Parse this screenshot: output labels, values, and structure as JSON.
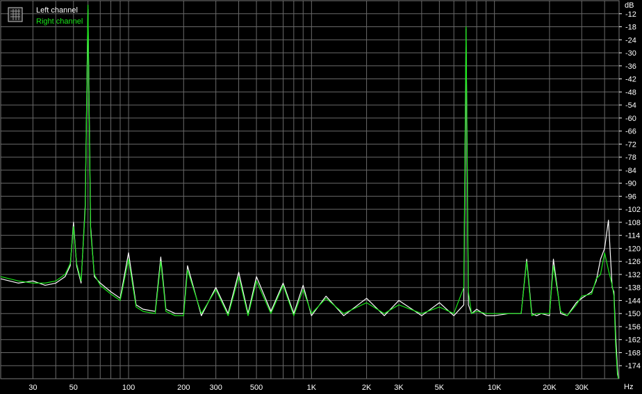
{
  "chart_data": {
    "type": "line",
    "title": "",
    "xlabel": "Hz",
    "ylabel": "dB",
    "x_scale": "log",
    "xlim": [
      20,
      48000
    ],
    "ylim": [
      -180,
      -6
    ],
    "grid": true,
    "legend_position": "top-left",
    "colors": {
      "background": "#000000",
      "grid": "#6a6a6a",
      "left": "#ffffff",
      "right": "#19e619",
      "text": "#ffffff"
    },
    "x_ticks": [
      {
        "v": 30,
        "label": "30"
      },
      {
        "v": 50,
        "label": "50"
      },
      {
        "v": 100,
        "label": "100"
      },
      {
        "v": 200,
        "label": "200"
      },
      {
        "v": 300,
        "label": "300"
      },
      {
        "v": 500,
        "label": "500"
      },
      {
        "v": 1000,
        "label": "1K"
      },
      {
        "v": 2000,
        "label": "2K"
      },
      {
        "v": 3000,
        "label": "3K"
      },
      {
        "v": 5000,
        "label": "5K"
      },
      {
        "v": 10000,
        "label": "10K"
      },
      {
        "v": 20000,
        "label": "20K"
      },
      {
        "v": 30000,
        "label": "30K"
      }
    ],
    "y_ticks": [
      -12,
      -18,
      -24,
      -30,
      -36,
      -42,
      -48,
      -54,
      -60,
      -66,
      -72,
      -78,
      -84,
      -90,
      -96,
      -102,
      -108,
      -114,
      -120,
      -126,
      -132,
      -138,
      -144,
      -150,
      -156,
      -162,
      -168,
      -174
    ],
    "series": [
      {
        "name": "Left channel",
        "x": [
          20,
          25,
          30,
          35,
          40,
          45,
          48,
          50,
          52,
          55,
          58,
          60,
          62,
          65,
          70,
          80,
          90,
          100,
          110,
          120,
          140,
          150,
          160,
          180,
          200,
          210,
          250,
          300,
          350,
          400,
          450,
          500,
          600,
          700,
          800,
          900,
          1000,
          1200,
          1500,
          2000,
          2500,
          3000,
          4000,
          5000,
          6000,
          6800,
          7000,
          7200,
          7500,
          8000,
          9000,
          10000,
          12000,
          14000,
          15000,
          16000,
          17000,
          18000,
          20000,
          21000,
          23000,
          25000,
          28000,
          30000,
          34000,
          36000,
          38000,
          40000,
          42000,
          44000,
          45000,
          46000,
          47000,
          48000
        ],
        "y": [
          -134,
          -136,
          -135,
          -137,
          -136,
          -133,
          -128,
          -108,
          -128,
          -136,
          -100,
          -10,
          -110,
          -133,
          -136,
          -140,
          -143,
          -122,
          -146,
          -148,
          -149,
          -124,
          -148,
          -150,
          -150,
          -128,
          -151,
          -138,
          -150,
          -131,
          -150,
          -133,
          -149,
          -136,
          -150,
          -137,
          -151,
          -142,
          -151,
          -143,
          -151,
          -144,
          -151,
          -145,
          -151,
          -146,
          -19,
          -146,
          -150,
          -148,
          -151,
          -151,
          -150,
          -150,
          -125,
          -150,
          -151,
          -150,
          -151,
          -125,
          -150,
          -151,
          -145,
          -143,
          -140,
          -135,
          -125,
          -120,
          -107,
          -138,
          -140,
          -160,
          -175,
          -180
        ]
      },
      {
        "name": "Right channel",
        "x": [
          20,
          25,
          30,
          35,
          40,
          45,
          48,
          50,
          52,
          55,
          58,
          60,
          62,
          65,
          70,
          80,
          90,
          100,
          110,
          120,
          140,
          150,
          160,
          180,
          200,
          210,
          250,
          300,
          350,
          400,
          450,
          500,
          600,
          700,
          800,
          900,
          1000,
          1200,
          1500,
          2000,
          2500,
          3000,
          4000,
          5000,
          6000,
          6800,
          7000,
          7200,
          7500,
          8000,
          9000,
          10000,
          12000,
          14000,
          15000,
          16000,
          17000,
          18000,
          20000,
          21000,
          23000,
          25000,
          28000,
          30000,
          34000,
          36000,
          38000,
          40000,
          42000,
          44000,
          45000,
          46000,
          47000,
          48000
        ],
        "y": [
          -133,
          -135,
          -136,
          -136,
          -135,
          -132,
          -127,
          -110,
          -127,
          -135,
          -102,
          -8,
          -112,
          -132,
          -137,
          -141,
          -144,
          -125,
          -147,
          -149,
          -150,
          -126,
          -149,
          -151,
          -151,
          -130,
          -150,
          -139,
          -151,
          -133,
          -151,
          -135,
          -150,
          -137,
          -151,
          -139,
          -150,
          -143,
          -150,
          -145,
          -150,
          -146,
          -150,
          -147,
          -150,
          -138,
          -18,
          -140,
          -150,
          -149,
          -150,
          -150,
          -150,
          -150,
          -126,
          -151,
          -150,
          -150,
          -150,
          -128,
          -149,
          -151,
          -146,
          -142,
          -141,
          -134,
          -132,
          -122,
          -130,
          -137,
          -142,
          -165,
          -178,
          -180
        ]
      }
    ]
  }
}
